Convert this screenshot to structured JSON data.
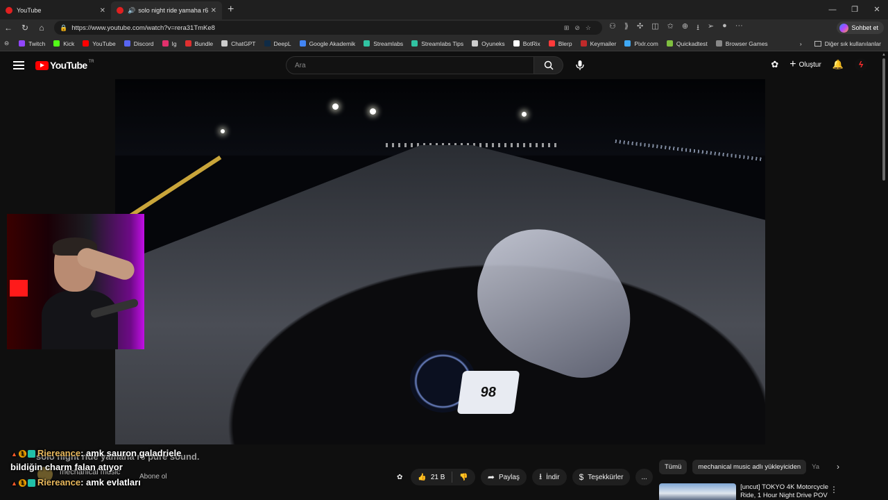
{
  "browser": {
    "tabs": [
      {
        "title": "YouTube",
        "active": false
      },
      {
        "title": "solo night ride yamaha r6 pur",
        "active": true
      }
    ],
    "url": "https://www.youtube.com/watch?v=rera31TmKe8",
    "chat_button": "Sohbet et",
    "bookmarks": [
      {
        "label": "Twitch",
        "color": "#9146ff"
      },
      {
        "label": "Kick",
        "color": "#53fc18"
      },
      {
        "label": "YouTube",
        "color": "#ff0000"
      },
      {
        "label": "Discord",
        "color": "#5865f2"
      },
      {
        "label": "Ig",
        "color": "#e1306c"
      },
      {
        "label": "Bundle",
        "color": "#e03030"
      },
      {
        "label": "ChatGPT",
        "color": "#cccccc"
      },
      {
        "label": "DeepL",
        "color": "#0f2b46"
      },
      {
        "label": "Google Akademik",
        "color": "#4285f4"
      },
      {
        "label": "Streamlabs",
        "color": "#31c3a2"
      },
      {
        "label": "Streamlabs Tips",
        "color": "#31c3a2"
      },
      {
        "label": "Oyuneks",
        "color": "#cccccc"
      },
      {
        "label": "BotRix",
        "color": "#ffffff"
      },
      {
        "label": "Blerp",
        "color": "#ff3a3a"
      },
      {
        "label": "Keymailer",
        "color": "#c02a2a"
      },
      {
        "label": "Pixlr.com",
        "color": "#3fa9f5"
      },
      {
        "label": "Quickadtest",
        "color": "#7fbf3f"
      },
      {
        "label": "Browser Games",
        "color": "#888888"
      }
    ],
    "other_bookmarks": "Diğer sık kullanılanlar"
  },
  "youtube": {
    "logo_text": "YouTube",
    "country_code": "TR",
    "search_placeholder": "Ara",
    "create_label": "Oluştur",
    "speedometer_reading": "98"
  },
  "video_info": {
    "title": "solo night ride yamaha r6 pure sound.",
    "channel": "mechanical music",
    "subscribe": "Abone ol",
    "likes": "21 B",
    "share": "Paylaş",
    "download": "İndir",
    "thanks": "Teşekkürler",
    "more": "..."
  },
  "chat": [
    {
      "user": "Riereance",
      "text": ": amk sauron galadriele",
      "badge": "1"
    },
    {
      "user": "",
      "text": "bildiğin charm falan atıyor",
      "badge": ""
    },
    {
      "user": "Riereance",
      "text": ": amk evlatları",
      "badge": "1"
    }
  ],
  "chips": {
    "all": "Tümü",
    "uploader": "mechanical music adlı yükleyiciden",
    "faded": "Ya"
  },
  "recommendation": {
    "title": "[uncut] TOKYO 4K Motorcycle Ride, 1 Hour Night Drive POV"
  }
}
